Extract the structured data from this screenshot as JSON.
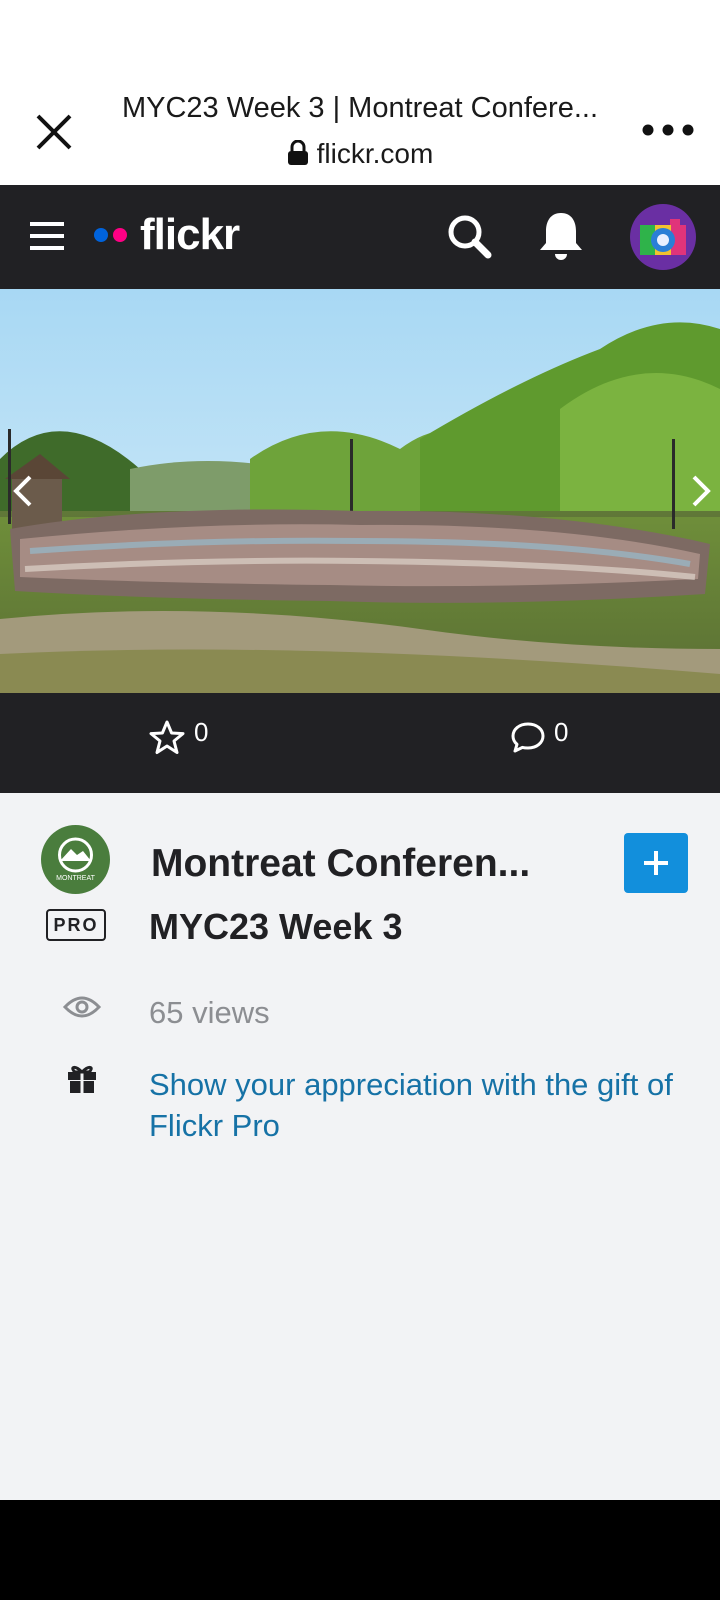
{
  "browser": {
    "page_title": "MYC23 Week 3 | Montreat Confere...",
    "url": "flickr.com"
  },
  "nav": {
    "logo_text": "flickr",
    "logo_colors": {
      "blue": "#0063dc",
      "pink": "#ff0084"
    }
  },
  "photo": {
    "faves_count": "0",
    "comments_count": "0"
  },
  "info": {
    "owner_name": "Montreat Conferen...",
    "pro_badge": "PRO",
    "photo_title": "MYC23 Week 3",
    "views": "65 views",
    "gift_text": "Show your appreciation with the gift of Flickr Pro"
  },
  "colors": {
    "nav_bg": "#212124",
    "follow_button": "#128fdc",
    "link": "#1672a6",
    "muted_text": "#8c8e92"
  },
  "icons": [
    "close-icon",
    "lock-icon",
    "more-icon",
    "menu-icon",
    "search-icon",
    "bell-icon",
    "star-icon",
    "comment-icon",
    "eye-icon",
    "gift-icon",
    "plus-icon",
    "chevron-left-icon",
    "chevron-right-icon"
  ]
}
